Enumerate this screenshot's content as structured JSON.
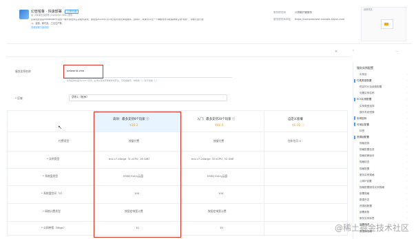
{
  "app": {
    "title": "幻兽帕鲁 · 快速部署",
    "title_badge": "云服务器",
    "desc_lines": [
      "由 计算巢在线部署 (Compute Nest) 提供",
      "幻兽帕鲁是由Pocketpair开发的一款开放世界生存制作游戏。该项目2024年1月19日发布抢先体验版本。游戏中，玩家可以在一个神秘世界中收集神奇生物\"帕鲁\"，派他们进行战",
      "斗、建造、耕作及、工业生产等。"
    ],
    "link": "查看部署方案说明",
    "meta": [
      {
        "label": "服务提供商",
        "value": "计算巢托管服务"
      },
      {
        "label": "服务提供商网址",
        "value": "https://computenest.console.aliyun.com"
      }
    ],
    "preview_label": "部署预览",
    "toolbar_icons": [
      "close-icon",
      "chevron-up-icon",
      "more-icon"
    ]
  },
  "form": {
    "name_label": "服务实例名称",
    "name_value": "palworld-zhw",
    "name_hint": "实例名称长度为2-64个字符，必须以英文字母或中文开头，可包含数字、中划线（-）和下划线（_）",
    "region_label": "* 区域",
    "region_value": "华东1（杭州）"
  },
  "plans": {
    "columns": [
      {
        "title": "高效：最多支持8个玩家 ⓘ",
        "price": "¥30.2",
        "highlight": true
      },
      {
        "title": "入门：最多支持20个玩家 ⓘ",
        "price": "¥40.6",
        "highlight": false
      },
      {
        "title": "自定义套餐",
        "price": "¥0.02 ⓘ",
        "highlight": false
      }
    ],
    "rows": [
      {
        "label": "付费类型",
        "values": [
          "按量付费",
          "按量付费",
          "包年包月 ⊙"
        ]
      },
      {
        "label": "* 实例类型",
        "values": [
          "ecs.c7.xlarge（4 vCPU, 16 GiB）",
          "ecs.c7.2xlarge（8 vCPU, 32 GiB）",
          ""
        ]
      },
      {
        "label": "* 系统盘类型",
        "values": [
          "ESSD Entry云盘",
          "ESSD Entry云盘",
          ""
        ]
      },
      {
        "label": "* 系统盘空间（G）",
        "values": [
          "100",
          "100",
          ""
        ]
      },
      {
        "label": "* 网络计费类型",
        "values": [
          "按固定带宽计费",
          "按固定带宽计费",
          ""
        ]
      },
      {
        "label": "* 公网带宽（Mbps）",
        "values": [
          "10",
          "10",
          ""
        ]
      }
    ]
  },
  "sidebar": {
    "title": "服务实例配置",
    "items": [
      {
        "label": "实例名",
        "level": 1,
        "active": false
      },
      {
        "label": "付费类型配置",
        "level": 0,
        "active": true
      },
      {
        "label": "购买时长及续费配置",
        "level": 1,
        "active": false
      },
      {
        "label": "设置实例名称",
        "level": 1,
        "active": false
      },
      {
        "label": "ECS实例配置",
        "level": 0,
        "active": true
      },
      {
        "label": "实例类型选择",
        "level": 1,
        "active": false
      },
      {
        "label": "操作系统镜像",
        "level": 1,
        "active": false
      },
      {
        "label": "实例密码",
        "level": 0,
        "active": true
      },
      {
        "label": "可用区配置",
        "level": 0,
        "active": true
      },
      {
        "label": "标签",
        "level": 1,
        "active": false
      },
      {
        "label": "资源组配置",
        "level": 0,
        "active": true
      },
      {
        "label": "规格选择",
        "level": 1,
        "active": false
      },
      {
        "label": "规格配置检查",
        "level": 1,
        "active": false
      },
      {
        "label": "规格依赖版本",
        "level": 1,
        "active": false
      },
      {
        "label": "规格检查",
        "level": 1,
        "active": false
      },
      {
        "label": "规格配置",
        "level": 1,
        "active": false
      },
      {
        "label": "服务实例规格",
        "level": 1,
        "active": false
      },
      {
        "label": "公网IP设置",
        "level": 1,
        "active": false
      },
      {
        "label": "规格配置服务实例规格",
        "level": 1,
        "active": false
      },
      {
        "label": "部署规格",
        "level": 1,
        "active": false
      },
      {
        "label": "数据开发",
        "level": 1,
        "active": false
      },
      {
        "label": "资源组配置",
        "level": 1,
        "active": false
      },
      {
        "label": "部署参数",
        "level": 1,
        "active": false
      },
      {
        "label": "服务实例标签",
        "level": 1,
        "active": false
      },
      {
        "label": "部署资源",
        "level": 1,
        "active": false
      },
      {
        "label": "数据库规格",
        "level": 1,
        "active": false
      }
    ]
  },
  "watermark": "@稀土掘金技术社区",
  "colors": {
    "accent": "#409eff",
    "price": "#e6a23c",
    "highlight_bg": "#e8f4ff",
    "red_box": "#d93026"
  }
}
